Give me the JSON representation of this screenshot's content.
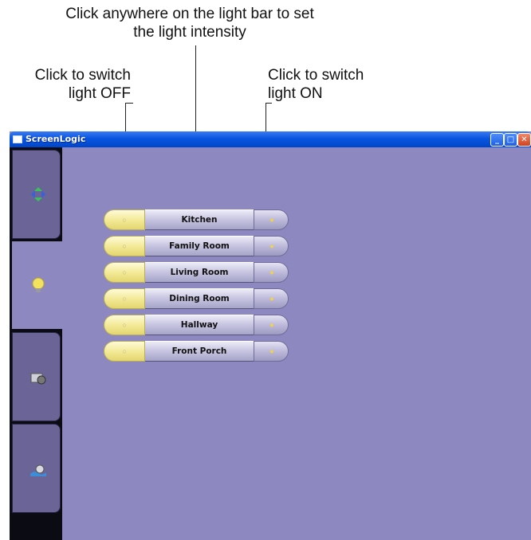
{
  "callouts": {
    "intensity_line1": "Click anywhere on the light bar to set",
    "intensity_line2": "the light intensity",
    "off_line1": "Click to switch",
    "off_line2": "light OFF",
    "on_line1": "Click to switch",
    "on_line2": "light ON"
  },
  "window": {
    "title": "ScreenLogic",
    "minimize_glyph": "_",
    "maximize_glyph": "□",
    "close_glyph": "✕"
  },
  "nav": {
    "tabs": [
      {
        "icon": "arrows-icon",
        "active": false
      },
      {
        "icon": "lightbulb-icon",
        "active": true
      },
      {
        "icon": "camera-icon",
        "active": false
      },
      {
        "icon": "pool-icon",
        "active": false
      }
    ]
  },
  "lights": [
    {
      "name": "Kitchen"
    },
    {
      "name": "Family Room"
    },
    {
      "name": "Living Room"
    },
    {
      "name": "Dining Room"
    },
    {
      "name": "Hallway"
    },
    {
      "name": "Front Porch"
    }
  ],
  "colors": {
    "background": "#8e88c0",
    "off_button": "#f2e893",
    "bar": "#c9c7e2",
    "titlebar": "#0a55e0"
  }
}
